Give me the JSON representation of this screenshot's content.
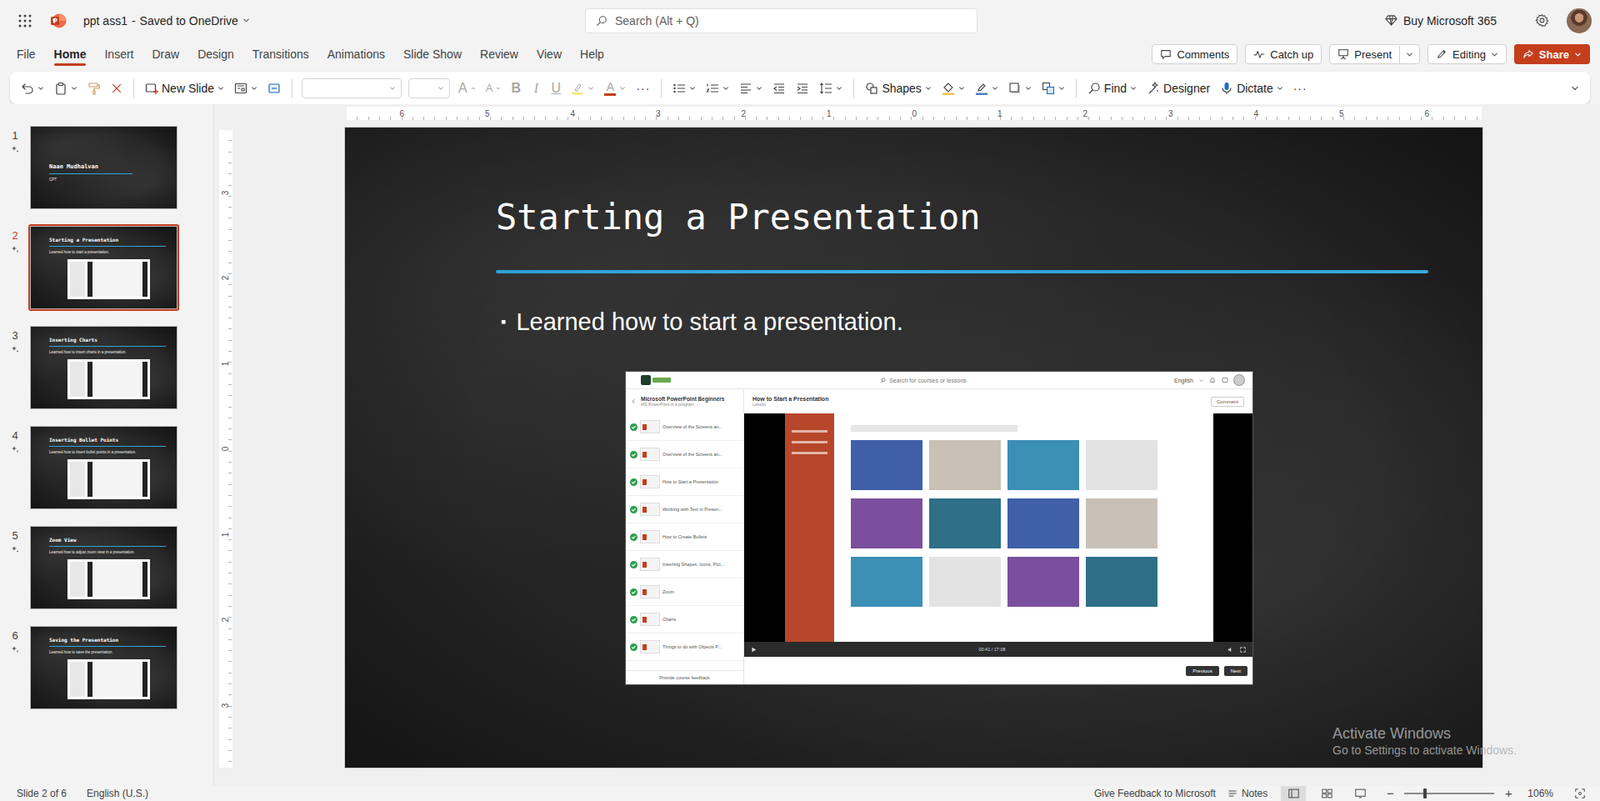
{
  "app": {
    "title": "ppt ass1",
    "separator": "-",
    "save_status": "Saved to OneDrive",
    "search_placeholder": "Search (Alt + Q)",
    "buy_label": "Buy Microsoft 365"
  },
  "menu_tabs": [
    {
      "label": "File",
      "selected": false
    },
    {
      "label": "Home",
      "selected": true
    },
    {
      "label": "Insert",
      "selected": false
    },
    {
      "label": "Draw",
      "selected": false
    },
    {
      "label": "Design",
      "selected": false
    },
    {
      "label": "Transitions",
      "selected": false
    },
    {
      "label": "Animations",
      "selected": false
    },
    {
      "label": "Slide Show",
      "selected": false
    },
    {
      "label": "Review",
      "selected": false
    },
    {
      "label": "View",
      "selected": false
    },
    {
      "label": "Help",
      "selected": false
    }
  ],
  "header_buttons": {
    "comments": "Comments",
    "catch_up": "Catch up",
    "present": "Present",
    "editing": "Editing",
    "share": "Share"
  },
  "ribbon": {
    "new_slide": "New Slide",
    "font_disabled": true,
    "grow_font": "A",
    "shrink_font": "A",
    "bold": "B",
    "italic": "I",
    "underline": "U",
    "font_color": "A",
    "more": "···",
    "shapes": "Shapes",
    "find": "Find",
    "designer": "Designer",
    "dictate": "Dictate",
    "overflow": "···"
  },
  "rulers": {
    "horizontal": [
      "6",
      "5",
      "4",
      "3",
      "2",
      "1",
      "0",
      "1",
      "2",
      "3",
      "4",
      "5",
      "6"
    ],
    "vertical": [
      "3",
      "2",
      "1",
      "0",
      "1",
      "2",
      "3"
    ]
  },
  "slides": [
    {
      "number": "1",
      "kind": "title",
      "title": "Naan Mudhalvan",
      "body": "CPT",
      "selected": false
    },
    {
      "number": "2",
      "kind": "content",
      "title": "Starting a Presentation",
      "body": "Learned how to start a presentation.",
      "selected": true
    },
    {
      "number": "3",
      "kind": "content",
      "title": "Inserting Charts",
      "body": "Learned how to insert charts in a presentation.",
      "selected": false
    },
    {
      "number": "4",
      "kind": "content",
      "title": "Inserting Bullet Points",
      "body": "Learned how to insert bullet points in a presentation.",
      "selected": false
    },
    {
      "number": "5",
      "kind": "content",
      "title": "Zoom View",
      "body": "Learned how to adjust zoom view in a presentation.",
      "selected": false
    },
    {
      "number": "6",
      "kind": "content",
      "title": "Saving the Presentation",
      "body": "Learned how to save the presentation.",
      "selected": false
    }
  ],
  "current_slide": {
    "title": "Starting a Presentation",
    "bullet_mark": "▪",
    "bullet": "Learned how to start a presentation.",
    "screenshot": {
      "search": "Search for courses or lessons",
      "language": "English",
      "course_title": "Microsoft PowerPoint Beginners",
      "course_subtitle": "MS PowerPoint is a program ...",
      "lesson_title": "How to Start a Presentation",
      "lesson_kind": "Lesson",
      "comment": "Comment",
      "lessons": [
        {
          "label": "Overview of the Screens an...",
          "done": true
        },
        {
          "label": "Overview of the Screens an...",
          "done": true
        },
        {
          "label": "How to Start a Presentation",
          "done": true
        },
        {
          "label": "Working with Text in Presen...",
          "done": true
        },
        {
          "label": "How to Create Bullets",
          "done": true
        },
        {
          "label": "Inserting Shapes, Icons, Pict...",
          "done": true
        },
        {
          "label": "Zoom",
          "done": true
        },
        {
          "label": "Charts",
          "done": true
        },
        {
          "label": "Things to do with Objects P...",
          "done": true
        }
      ],
      "feedback": "Provide course feedback",
      "time": "00:41 / 17:08",
      "previous": "Previous",
      "next": "Next"
    }
  },
  "watermark": {
    "title": "Activate Windows",
    "text": "Go to Settings to activate Windows."
  },
  "status_bar": {
    "slide": "Slide 2 of 6",
    "language": "English (U.S.)",
    "feedback": "Give Feedback to Microsoft",
    "notes": "Notes",
    "views": [
      {
        "kind": "normal",
        "selected": true
      },
      {
        "kind": "sorter",
        "selected": false
      },
      {
        "kind": "reading",
        "selected": false
      }
    ],
    "zoom_out": "−",
    "zoom_in": "+",
    "zoom_level": 0.23,
    "zoom": "106%"
  }
}
